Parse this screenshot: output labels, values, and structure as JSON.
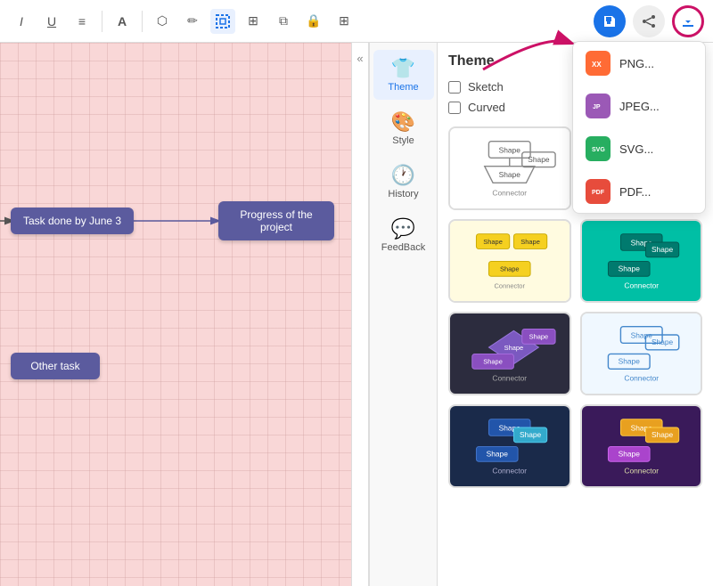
{
  "toolbar": {
    "icons": [
      "I",
      "U",
      "≡",
      "A",
      "⬡",
      "✏",
      "▣",
      "⊞",
      "≋",
      "🔒",
      "⊞"
    ],
    "save_label": "Save",
    "share_label": "Share",
    "export_label": "Export"
  },
  "canvas": {
    "node1_text": "Task done by June 3",
    "node2_text": "Progress of the\nproject",
    "node3_text": "Other task"
  },
  "panel_toggle": "«",
  "side_panel": {
    "items": [
      {
        "id": "theme",
        "label": "Theme",
        "icon": "👕",
        "active": true
      },
      {
        "id": "style",
        "label": "Style",
        "icon": "🎨",
        "active": false
      },
      {
        "id": "history",
        "label": "History",
        "icon": "🕐",
        "active": false
      },
      {
        "id": "feedback",
        "label": "FeedBack",
        "icon": "💬",
        "active": false
      }
    ]
  },
  "theme_panel": {
    "title": "Theme",
    "sketch_label": "Sketch",
    "curved_label": "Curved",
    "sketch_checked": false,
    "curved_checked": false
  },
  "export_menu": {
    "items": [
      {
        "id": "png",
        "label": "PNG...",
        "icon_color": "#ff6b35",
        "icon_text": "XX"
      },
      {
        "id": "jpeg",
        "label": "JPEG...",
        "icon_color": "#9b59b6",
        "icon_text": "JP"
      },
      {
        "id": "svg",
        "label": "SVG...",
        "icon_color": "#27ae60",
        "icon_text": "SVG"
      },
      {
        "id": "pdf",
        "label": "PDF...",
        "icon_color": "#e74c3c",
        "icon_text": "PDF"
      }
    ]
  },
  "theme_cards": [
    {
      "id": "default",
      "bg": "#ffffff",
      "border": "#cccccc"
    },
    {
      "id": "orange",
      "bg": "#ffe0c0",
      "border": "#dddddd"
    },
    {
      "id": "yellow",
      "bg": "#fff3b0",
      "border": "#dddddd"
    },
    {
      "id": "teal",
      "bg": "#00bfa5",
      "border": "#00bfa5"
    },
    {
      "id": "dark",
      "bg": "#2c2c3e",
      "border": "#2c2c3e"
    },
    {
      "id": "light-blue",
      "bg": "#e8f4ff",
      "border": "#bbddff"
    },
    {
      "id": "navy",
      "bg": "#1a2a4a",
      "border": "#1a2a4a"
    },
    {
      "id": "purple",
      "bg": "#4a1a6a",
      "border": "#4a1a6a"
    }
  ],
  "connector_label": "Connector"
}
